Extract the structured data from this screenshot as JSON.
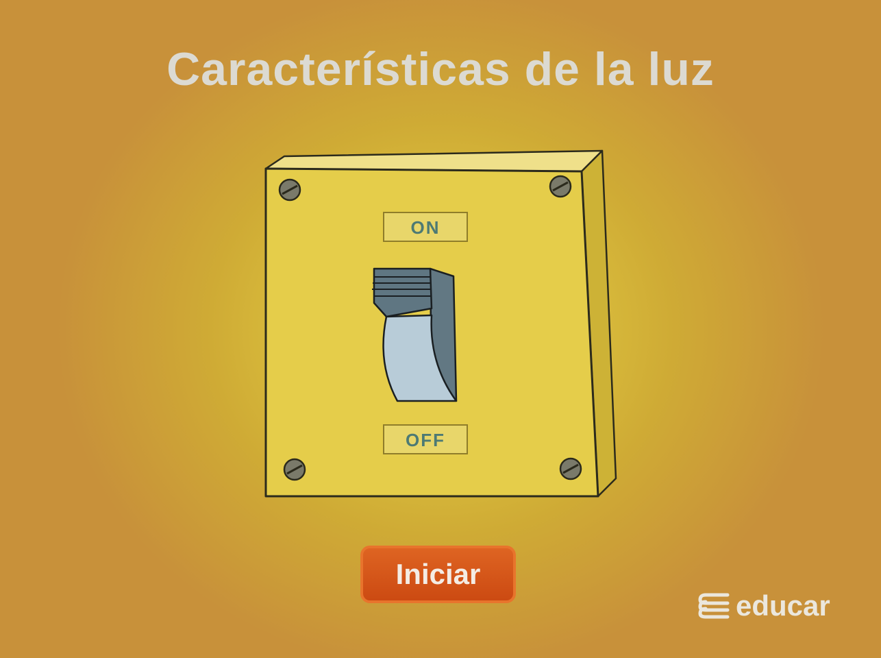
{
  "title": "Características de la luz",
  "switch": {
    "label_on": "ON",
    "label_off": "OFF",
    "state": "off"
  },
  "start_button": {
    "label": "Iniciar"
  },
  "logo": {
    "text": "educar"
  },
  "colors": {
    "background_center": "#e6d04a",
    "background_edge": "#c8913a",
    "title": "#dcdad2",
    "plate_face": "#e5cd4a",
    "plate_side": "#cdb236",
    "toggle_dark": "#627883",
    "toggle_light": "#b8ccd8",
    "button": "#d4521a",
    "logo": "#ebe7dd"
  },
  "icons": {
    "screws": "screw-icon",
    "logo": "educar-logo-icon"
  }
}
